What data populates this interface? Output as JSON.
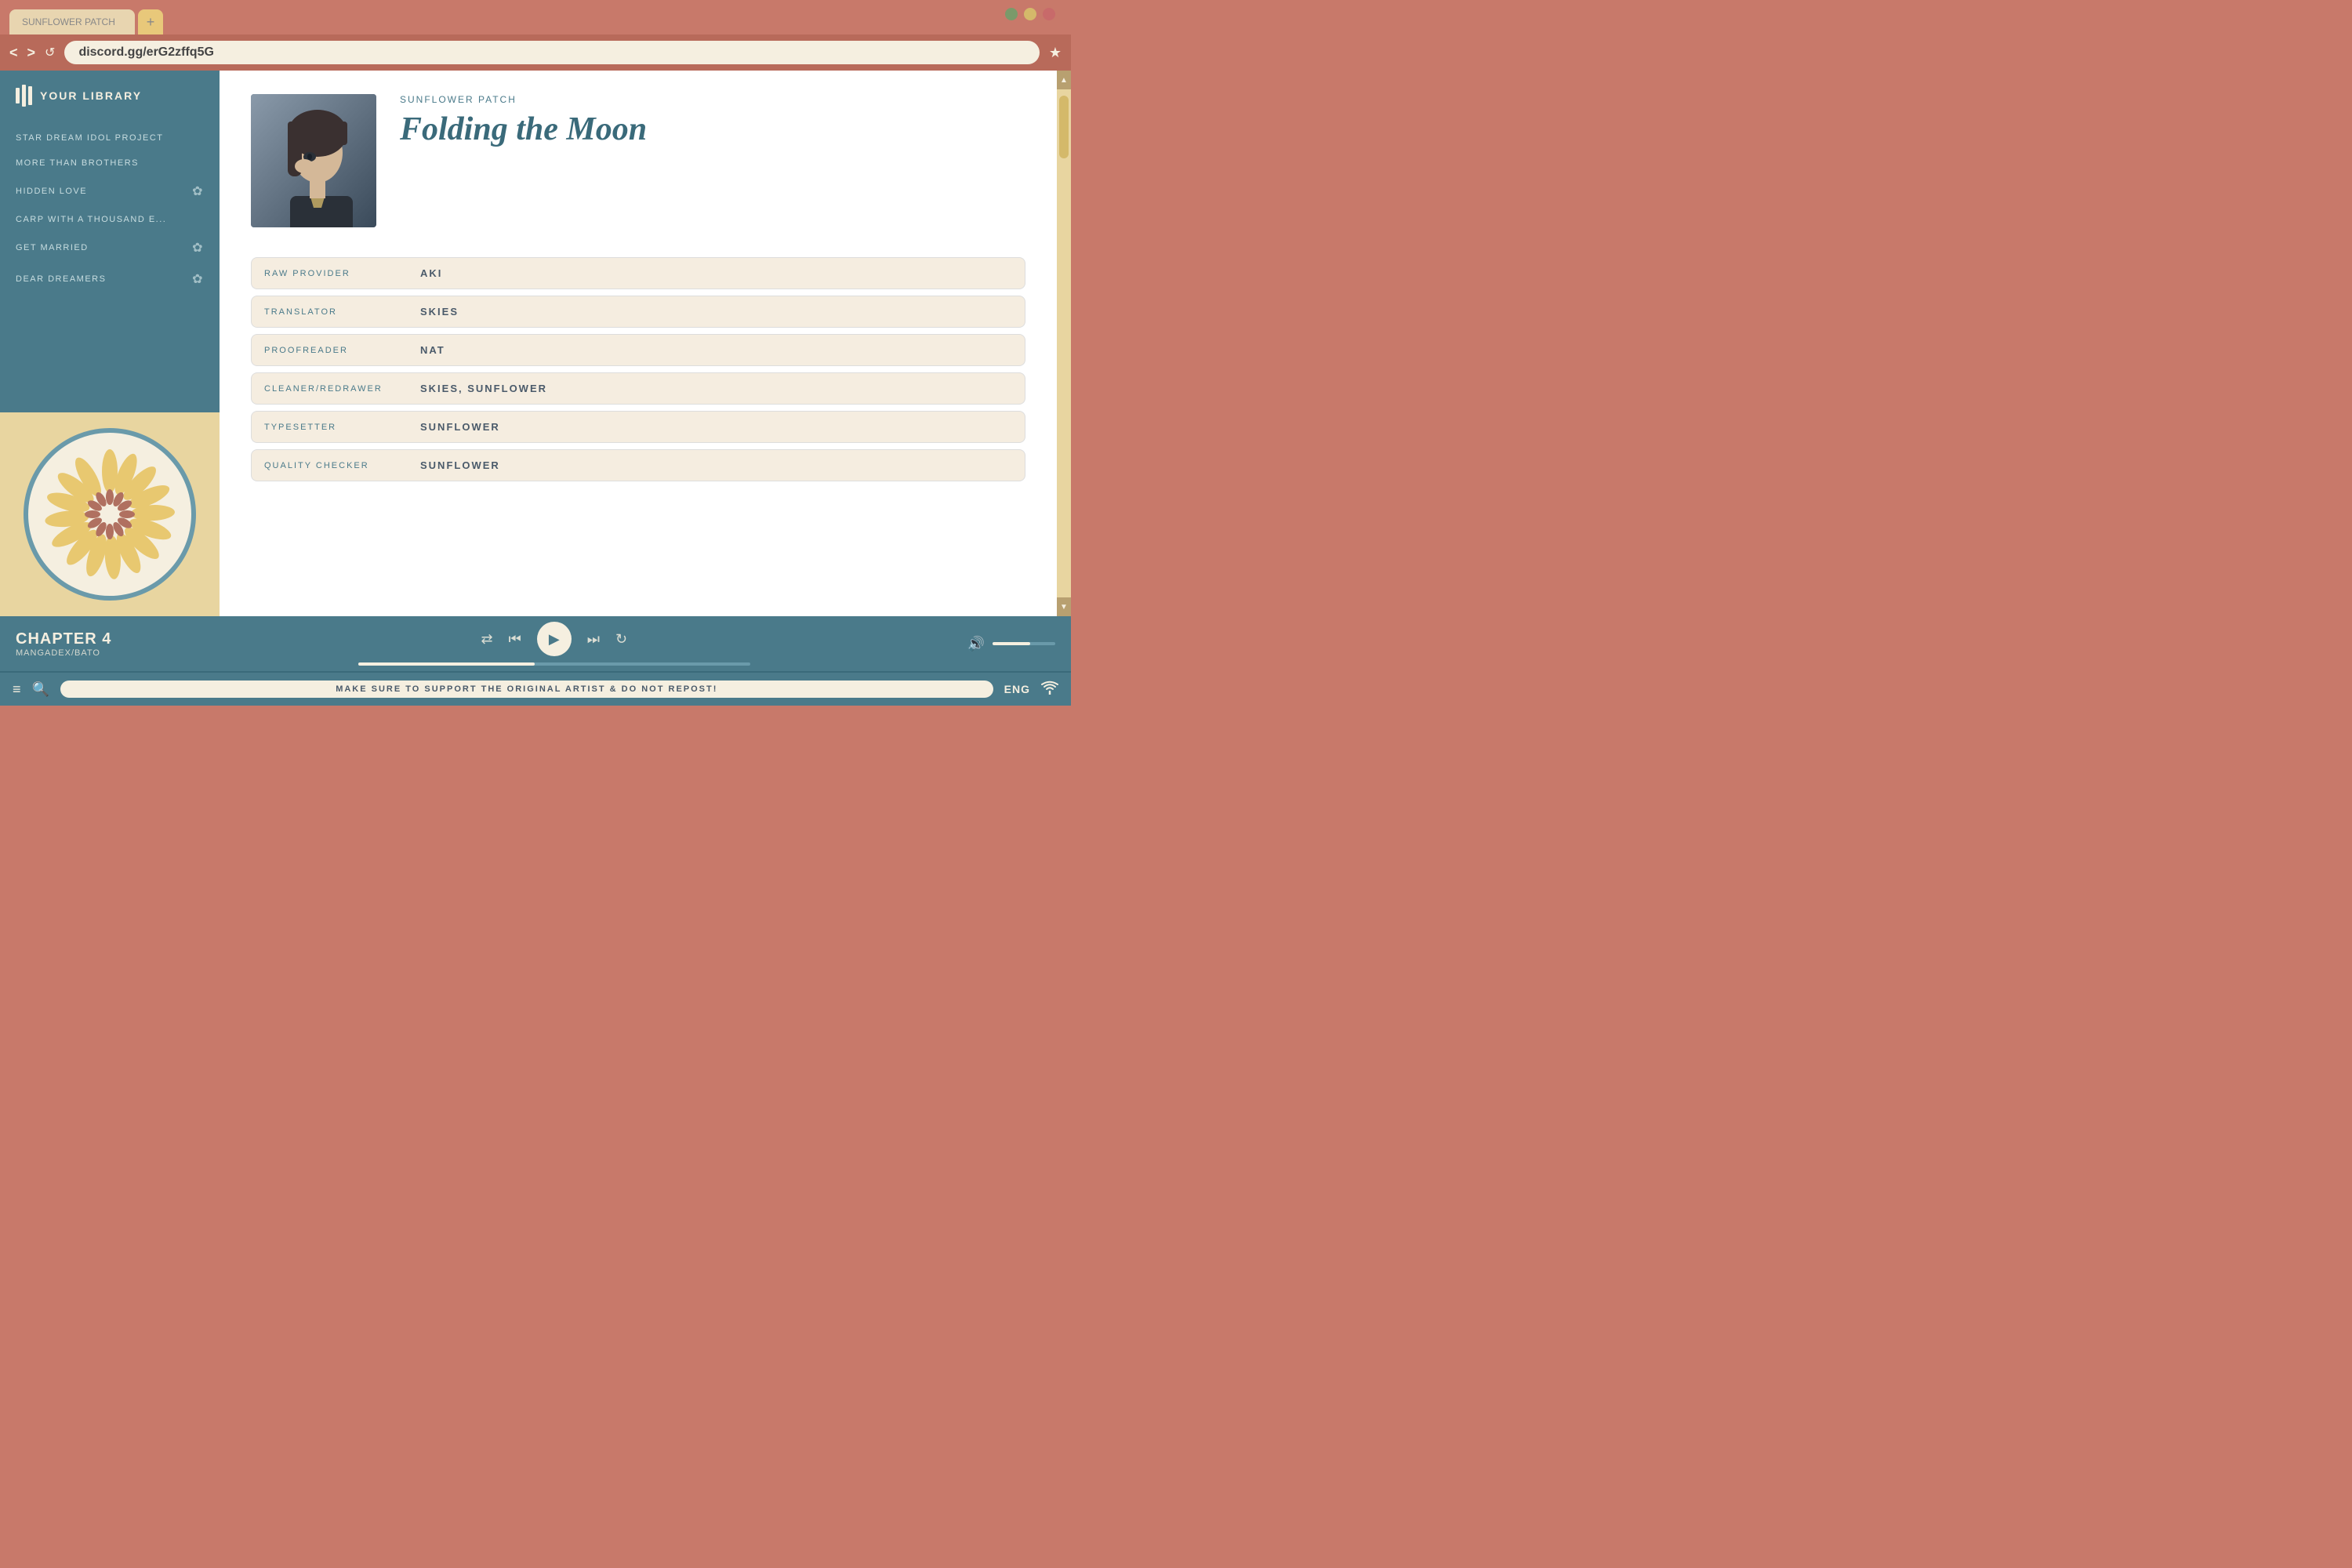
{
  "browser": {
    "tab_label": "SUNFLOWER PATCH",
    "tab_add": "+",
    "address": "discord.gg/erG2zffq5G",
    "nav_back": "<",
    "nav_forward": ">",
    "nav_reload": "↺",
    "bookmark": "★",
    "win_close": "●",
    "win_min": "●",
    "win_max": "●"
  },
  "sidebar": {
    "library_title": "YOUR LIBRARY",
    "items": [
      {
        "label": "STAR DREAM IDOL PROJECT",
        "has_icon": false
      },
      {
        "label": "MORE THAN BROTHERS",
        "has_icon": false
      },
      {
        "label": "HIDDEN LOVE",
        "has_icon": true
      },
      {
        "label": "CARP WITH A THOUSAND E...",
        "has_icon": false
      },
      {
        "label": "GET MARRIED",
        "has_icon": true
      },
      {
        "label": "DEAR DREAMERS",
        "has_icon": true
      }
    ]
  },
  "manga": {
    "series": "SUNFLOWER PATCH",
    "title": "Folding the Moon",
    "credits": [
      {
        "role": "RAW PROVIDER",
        "name": "AKI"
      },
      {
        "role": "TRANSLATOR",
        "name": "SKIES"
      },
      {
        "role": "PROOFREADER",
        "name": "NAT"
      },
      {
        "role": "CLEANER/REDRAWER",
        "name": "SKIES, SUNFLOWER"
      },
      {
        "role": "TYPESETTER",
        "name": "SUNFLOWER"
      },
      {
        "role": "QUALITY CHECKER",
        "name": "SUNFLOWER"
      }
    ]
  },
  "player": {
    "chapter_label": "CHAPTER 4",
    "source": "MANGADEX/BATO",
    "shuffle_icon": "⇄",
    "prev_icon": "⏮",
    "play_icon": "▶",
    "next_icon": "⏭",
    "repeat_icon": "↻",
    "volume_icon": "🔊",
    "progress_pct": 45,
    "volume_pct": 60
  },
  "toolbar": {
    "menu_icon": "≡",
    "search_icon": "🔍",
    "notice": "MAKE SURE TO SUPPORT THE ORIGINAL ARTIST & DO NOT REPOST!",
    "language": "ENG",
    "wifi_icon": "WiFi"
  },
  "colors": {
    "teal": "#4a7a8a",
    "rose": "#c8796a",
    "cream": "#f5efe0",
    "gold": "#d4b96a"
  }
}
